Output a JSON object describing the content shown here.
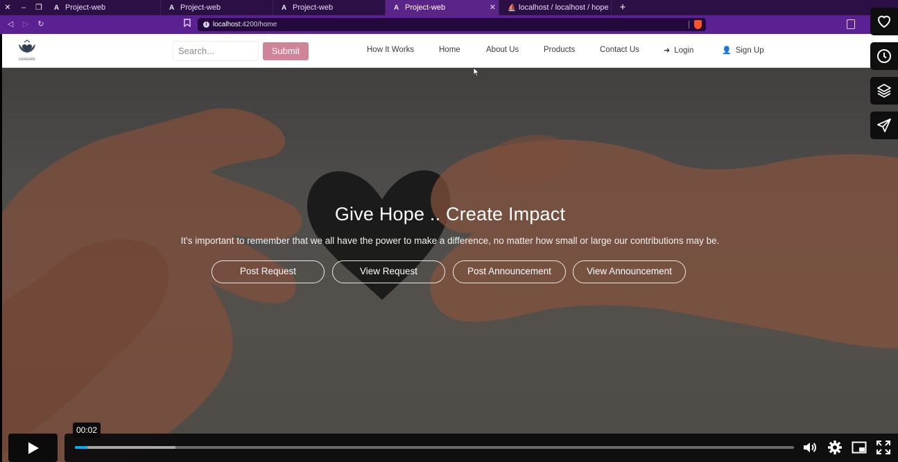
{
  "browser": {
    "tabs": [
      {
        "label": "Project-web",
        "favicon": "A",
        "active": false
      },
      {
        "label": "Project-web",
        "favicon": "A",
        "active": false
      },
      {
        "label": "Project-web",
        "favicon": "A",
        "active": false
      },
      {
        "label": "Project-web",
        "favicon": "A",
        "active": true
      },
      {
        "label": "localhost / localhost / hope / us",
        "favicon": "phpmyadmin-icon",
        "active": false
      }
    ],
    "new_tab": "+",
    "url_host": "localhost",
    "url_rest": ":4200/home"
  },
  "site": {
    "search_placeholder": "Search...",
    "submit_label": "Submit",
    "logo_text": "GIVEHOPE",
    "menu": {
      "how_it_works": "How It Works",
      "home": "Home",
      "about_us": "About Us",
      "products": "Products",
      "contact_us": "Contact Us",
      "login": "Login",
      "sign_up": "Sign Up"
    },
    "hero": {
      "title": "Give Hope .. Create Impact",
      "subtitle": "It's important to remember that we all have the power to make a difference, no matter how small or large our contributions may be.",
      "buttons": {
        "post_request": "Post Request",
        "view_request": "View Request",
        "post_announcement": "Post Announcement",
        "view_announcement": "View Announcement"
      }
    }
  },
  "player": {
    "time_tooltip": "00:02",
    "progress": 0.017,
    "buffered": 0.14,
    "accent_color": "#00adef"
  },
  "side_actions": [
    "heart-icon",
    "clock-icon",
    "layers-icon",
    "send-icon"
  ],
  "colors": {
    "brand_purple": "#5b2091",
    "submit_pink": "#cf8497"
  }
}
